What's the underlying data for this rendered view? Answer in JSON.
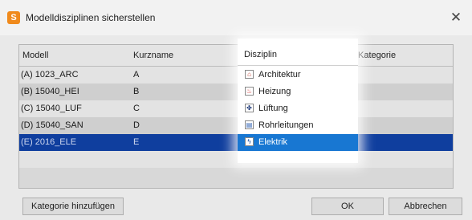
{
  "window": {
    "title": "Modelldisziplinen sicherstellen",
    "app_icon_letter": "S",
    "close_glyph": "✕"
  },
  "grid": {
    "columns": [
      "Modell",
      "Kurzname",
      "Disziplin",
      "Kategorie"
    ],
    "rows": [
      {
        "modell": "(A) 1023_ARC",
        "kurzname": "A",
        "disziplin": "Architektur",
        "icon": "architecture-icon",
        "glyph": "⌂",
        "icon_color": "#c0392b"
      },
      {
        "modell": "(B) 15040_HEI",
        "kurzname": "B",
        "disziplin": "Heizung",
        "icon": "heating-icon",
        "glyph": "♨",
        "icon_color": "#d32f2f"
      },
      {
        "modell": "(C) 15040_LUF",
        "kurzname": "C",
        "disziplin": "Lüftung",
        "icon": "ventilation-icon",
        "glyph": "✤",
        "icon_color": "#1f3a7a"
      },
      {
        "modell": "(D) 15040_SAN",
        "kurzname": "D",
        "disziplin": "Rohrleitungen",
        "icon": "piping-icon",
        "glyph": "▤",
        "icon_color": "#2a5db0"
      },
      {
        "modell": "(E) 2016_ELE",
        "kurzname": "E",
        "disziplin": "Elektrik",
        "icon": "electrical-icon",
        "glyph": "ϟ",
        "icon_color": "#0d47a1",
        "selected": true
      }
    ]
  },
  "buttons": {
    "add_category": "Kategorie hinzufügen",
    "ok": "OK",
    "cancel": "Abbrechen"
  },
  "colors": {
    "accent": "#f08a1c",
    "selection_row": "#0f3e9e",
    "selection_highlight": "#1877d2"
  }
}
